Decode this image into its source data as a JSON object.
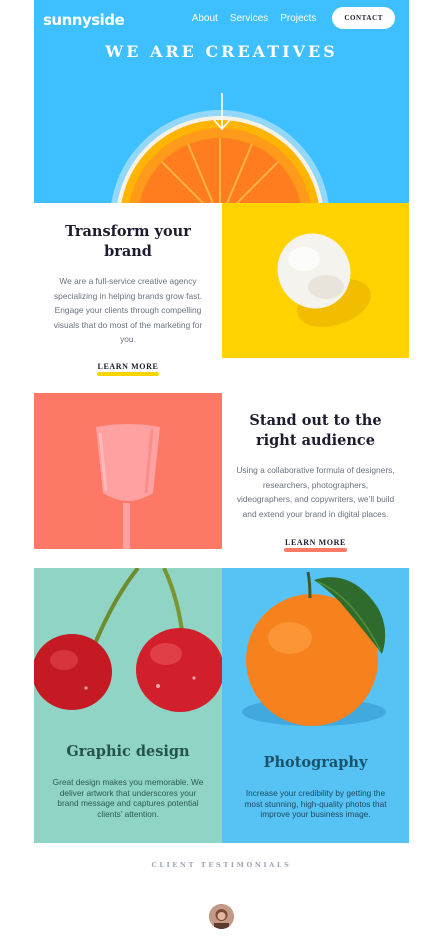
{
  "brand": {
    "logo": "sunnyside"
  },
  "nav": {
    "items": [
      "About",
      "Services",
      "Projects"
    ],
    "contact": "CONTACT"
  },
  "hero": {
    "title": "WE ARE CREATIVES"
  },
  "transform": {
    "heading_line1": "Transform your",
    "heading_line2": "brand",
    "body_lines": [
      "We are a full-service creative agency",
      "specializing in helping brands grow fast.",
      "Engage your clients through compelling",
      "visuals that do most of the marketing for",
      "you."
    ],
    "cta": "LEARN MORE"
  },
  "standout": {
    "heading_line1": "Stand out to the",
    "heading_line2": "right audience",
    "body_lines": [
      "Using a collaborative formula of designers,",
      "researchers, photographers,",
      "videographers, and copywriters, we’ll build",
      "and extend your brand in digital places."
    ],
    "cta": "LEARN MORE"
  },
  "graphic": {
    "title": "Graphic design",
    "body_lines": [
      "Great design makes you memorable. We",
      "deliver artwork that underscores your",
      "brand message and captures potential",
      "clients’ attention."
    ]
  },
  "photography": {
    "title": "Photography",
    "body_lines": [
      "Increase your credibility by getting the",
      "most stunning, high-quality photos that",
      "improve your business image."
    ]
  },
  "testimonials": {
    "label": "CLIENT TESTIMONIALS"
  },
  "colors": {
    "hero_blue": "#3ebfff",
    "yellow": "#ffd200",
    "coral": "#fe7866",
    "mint": "#90d4c5",
    "sky": "#57c3f5",
    "dark": "#1c1c2e"
  },
  "icons": {
    "hero_arrow": "arrow-down-icon"
  }
}
